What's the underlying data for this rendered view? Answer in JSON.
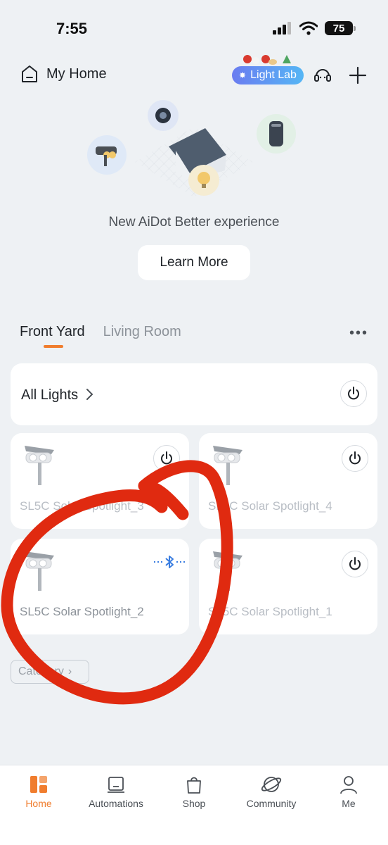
{
  "status_bar": {
    "time": "7:55",
    "battery": "75"
  },
  "header": {
    "home_label": "My Home",
    "light_lab_label": "Light Lab"
  },
  "hero": {
    "text": "New AiDot Better experience",
    "learn_more": "Learn More"
  },
  "tabs": [
    {
      "label": "Front Yard",
      "active": true
    },
    {
      "label": "Living Room",
      "active": false
    }
  ],
  "all_lights": {
    "label": "All Lights"
  },
  "devices": [
    {
      "name": "SL5C Solar Spotlight_3",
      "control": "power-icon"
    },
    {
      "name": "SL5C Solar Spotlight_4",
      "control": "power-icon"
    },
    {
      "name": "SL5C Solar Spotlight_2",
      "control": "bluetooth-icon"
    },
    {
      "name": "SL5C Solar Spotlight_1",
      "control": "power-icon"
    }
  ],
  "category_chip": {
    "label": "Category"
  },
  "bottom_nav": [
    {
      "label": "Home",
      "active": true
    },
    {
      "label": "Automations",
      "active": false
    },
    {
      "label": "Shop",
      "active": false
    },
    {
      "label": "Community",
      "active": false
    },
    {
      "label": "Me",
      "active": false
    }
  ],
  "colors": {
    "accent": "#f07d2e",
    "annotation": "#e02a10",
    "bluetooth": "#3a7de0"
  }
}
